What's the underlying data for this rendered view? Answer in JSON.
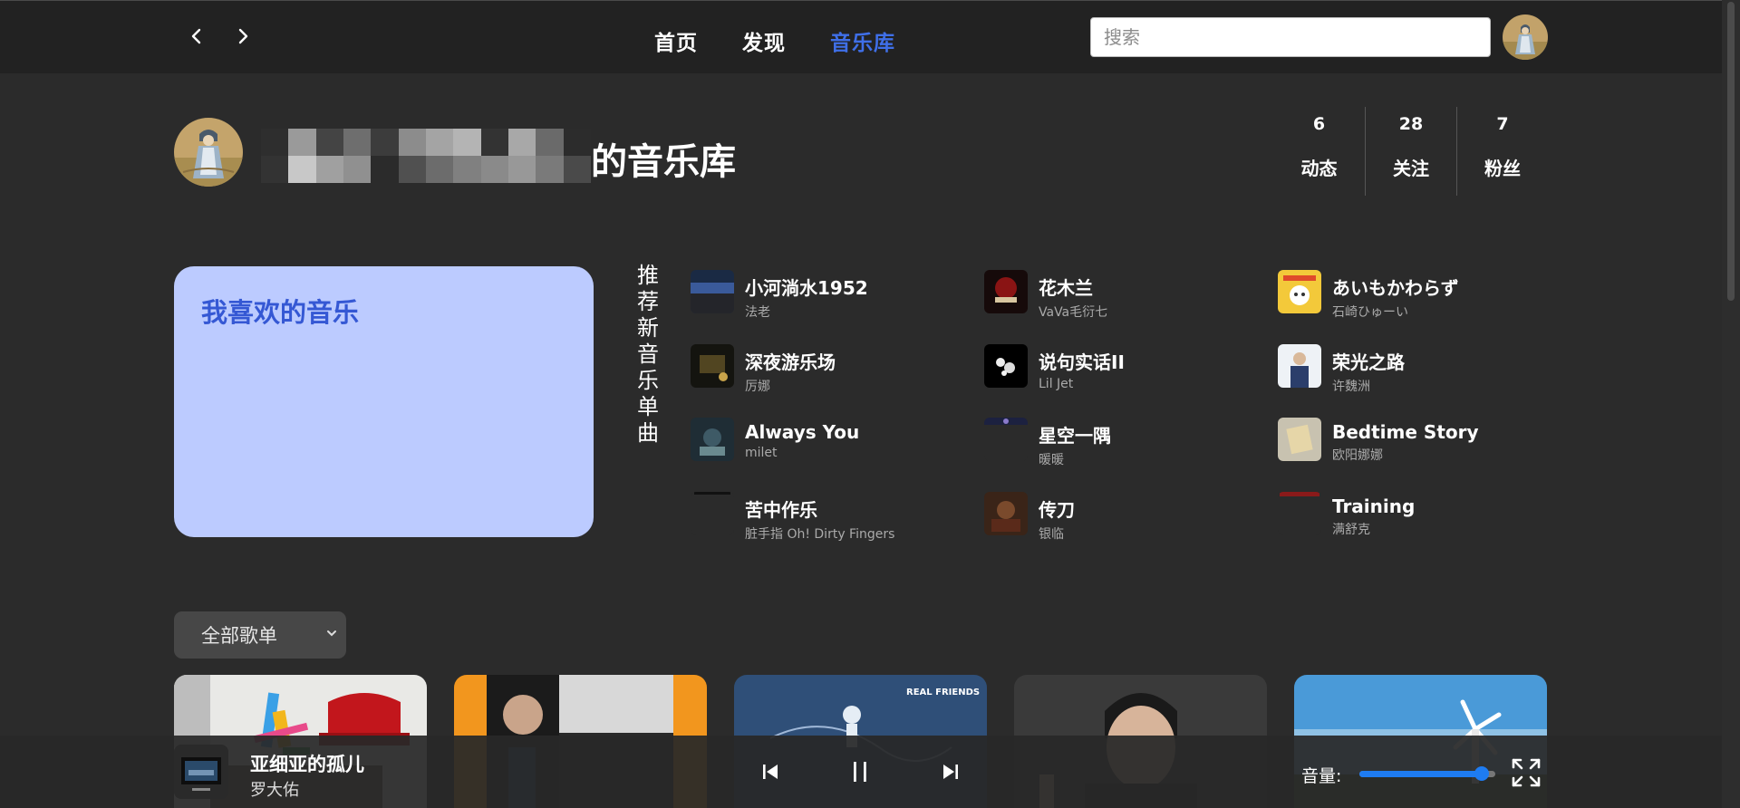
{
  "nav": {
    "back_icon": "chevron-left-icon",
    "forward_icon": "chevron-right-icon",
    "links": [
      {
        "label": "首页",
        "active": false
      },
      {
        "label": "发现",
        "active": false
      },
      {
        "label": "音乐库",
        "active": true
      }
    ],
    "search_placeholder": "搜索",
    "active_color": "#3f6fe8"
  },
  "profile": {
    "library_title": "的音乐库",
    "stats": [
      {
        "value": "6",
        "label": "动态"
      },
      {
        "value": "28",
        "label": "关注"
      },
      {
        "value": "7",
        "label": "粉丝"
      }
    ]
  },
  "liked": {
    "title": "我喜欢的音乐",
    "card_color": "#bccbff",
    "title_color": "#3558d4"
  },
  "recommend": {
    "label": "推荐新音乐单曲",
    "songs": [
      {
        "name": "小河淌水1952",
        "artist": "法老"
      },
      {
        "name": "花木兰",
        "artist": "VaVa毛衍七"
      },
      {
        "name": "あいもかわらず",
        "artist": "石崎ひゅーい"
      },
      {
        "name": "深夜游乐场",
        "artist": "厉娜"
      },
      {
        "name": "说句实话II",
        "artist": "Lil Jet"
      },
      {
        "name": "荣光之路",
        "artist": "许魏洲"
      },
      {
        "name": "Always You",
        "artist": "milet"
      },
      {
        "name": "星空一隅",
        "artist": "暖暖"
      },
      {
        "name": "Bedtime Story",
        "artist": "欧阳娜娜"
      },
      {
        "name": "苦中作乐",
        "artist": "脏手指 Oh! Dirty Fingers"
      },
      {
        "name": "传刀",
        "artist": "银临"
      },
      {
        "name": "Training",
        "artist": "满舒克"
      }
    ]
  },
  "playlists": {
    "filter_label": "全部歌单",
    "cover_labels": [
      "REAL FRIENDS"
    ]
  },
  "player": {
    "title": "亚细亚的孤儿",
    "artist": "罗大佑",
    "volume_label": "音量:",
    "volume_level": 0.9,
    "state": "playing",
    "accent": "#1e7cf2"
  }
}
